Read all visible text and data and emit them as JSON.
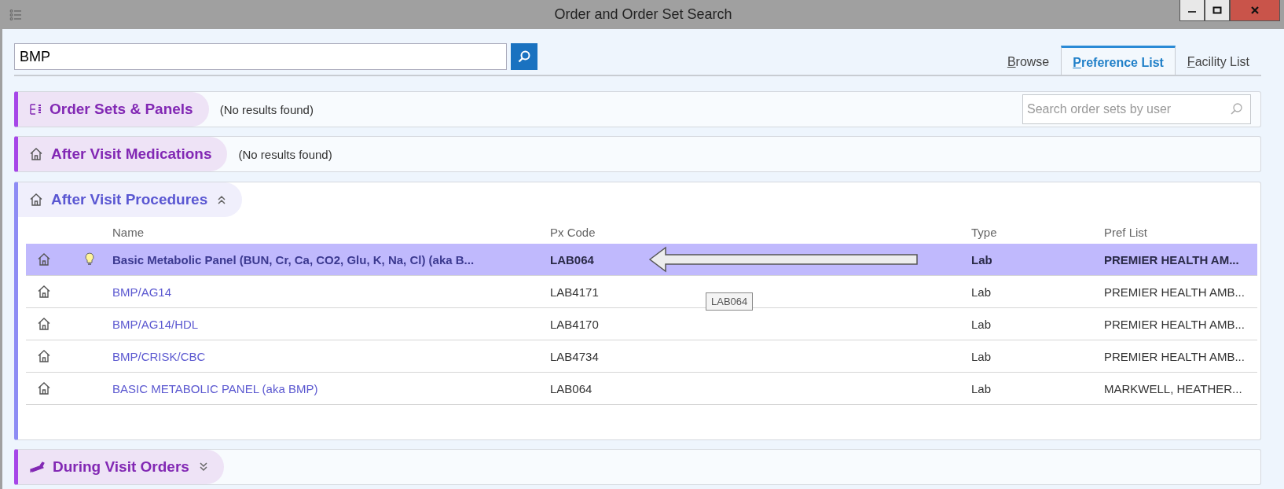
{
  "window": {
    "title": "Order and Order Set Search"
  },
  "search": {
    "value": "BMP"
  },
  "tabs": [
    {
      "label": "Browse",
      "selected": false
    },
    {
      "label": "Preference List",
      "selected": true
    },
    {
      "label": "Facility List",
      "selected": false
    }
  ],
  "sections": [
    {
      "kind": "panels",
      "title": "Order Sets & Panels",
      "note": "(No results found)",
      "user_search": {
        "placeholder": "Search order sets by user"
      }
    },
    {
      "kind": "medications",
      "title": "After Visit Medications",
      "note": "(No results found)"
    },
    {
      "kind": "procedures",
      "title": "After Visit Procedures",
      "expanded": true,
      "table": {
        "columns": [
          "Name",
          "Px Code",
          "Type",
          "Pref List"
        ],
        "rows": [
          {
            "selected": true,
            "flagged": true,
            "name": "Basic Metabolic Panel (BUN, Cr, Ca, CO2, Glu, K, Na, Cl) (aka B...",
            "px_code": "LAB064",
            "type": "Lab",
            "pref_list": "PREMIER HEALTH AM..."
          },
          {
            "selected": false,
            "flagged": false,
            "name": "BMP/AG14",
            "px_code": "LAB4171",
            "type": "Lab",
            "pref_list": "PREMIER HEALTH AMB..."
          },
          {
            "selected": false,
            "flagged": false,
            "name": "BMP/AG14/HDL",
            "px_code": "LAB4170",
            "type": "Lab",
            "pref_list": "PREMIER HEALTH AMB..."
          },
          {
            "selected": false,
            "flagged": false,
            "name": "BMP/CRISK/CBC",
            "px_code": "LAB4734",
            "type": "Lab",
            "pref_list": "PREMIER HEALTH AMB..."
          },
          {
            "selected": false,
            "flagged": false,
            "name": "BASIC METABOLIC PANEL (aka BMP)",
            "px_code": "LAB064",
            "type": "Lab",
            "pref_list": "MARKWELL, HEATHER..."
          }
        ]
      },
      "tooltip": "LAB064"
    },
    {
      "kind": "orders",
      "title": "During Visit Orders",
      "expanded": false
    }
  ]
}
